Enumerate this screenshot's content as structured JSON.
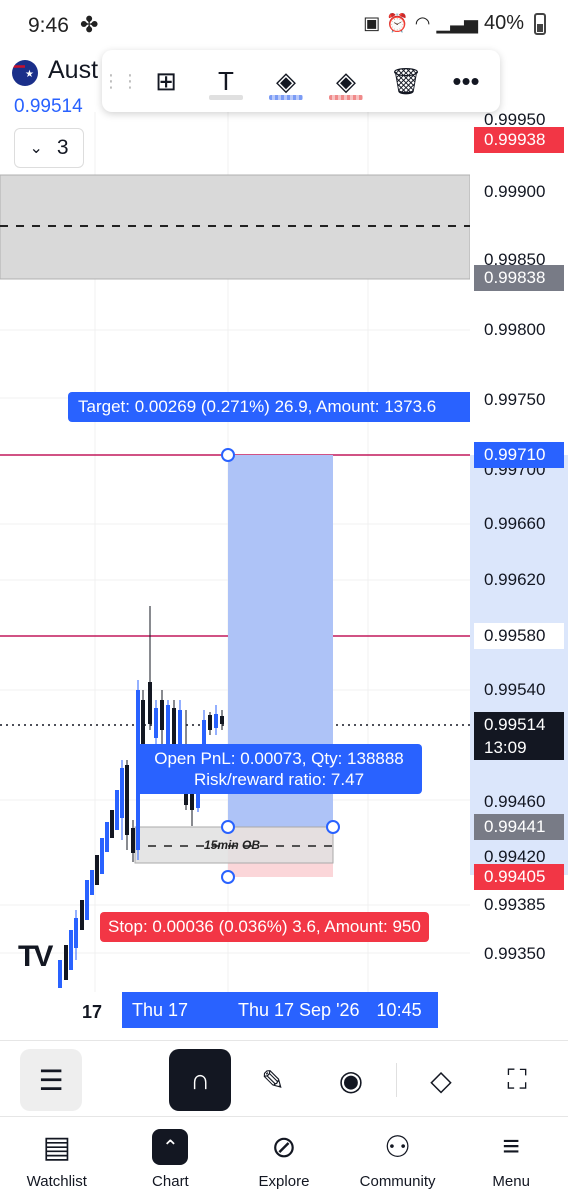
{
  "status_bar": {
    "time": "9:46",
    "battery": "40%"
  },
  "header": {
    "symbol": "Aust",
    "last_price": "0.99514",
    "interval": "3"
  },
  "drawing_toolbar": {
    "tools": [
      "drag-handle-icon",
      "add-object-icon",
      "text-icon",
      "fill-blue-icon",
      "fill-red-icon",
      "trash-icon",
      "more-icon"
    ]
  },
  "price_scale": {
    "ticks": [
      "0.99950",
      "0.99900",
      "0.99850",
      "0.99800",
      "0.99750",
      "0.99700",
      "0.99660",
      "0.99620",
      "0.99540",
      "0.99460",
      "0.99420",
      "0.99385",
      "0.99350"
    ],
    "labels": {
      "red_top": "0.99938",
      "grey_top": "0.99838",
      "blue_target": "0.99710",
      "red_mid": "0.99580",
      "current": "0.99514",
      "countdown": "13:09",
      "grey_entry": "0.99441",
      "red_stop": "0.99405"
    },
    "colors": {
      "red": "#f23645",
      "grey": "#787b86",
      "blue": "#2962ff",
      "black": "#131722"
    }
  },
  "position_tool": {
    "target_label": "Target: 0.00269 (0.271%) 26.9, Amount: 1373.6",
    "open_pnl": "Open PnL: 0.00073, Qty: 138888",
    "risk_reward": "Risk/reward ratio: 7.47",
    "stop_label": "Stop: 0.00036 (0.036%) 3.6, Amount: 950"
  },
  "annotations": {
    "order_block": "15min OB"
  },
  "time_axis": {
    "day_label": "17",
    "crosshair_left": "Thu 17 Sep",
    "crosshair_main": "Thu 17 Sep '26",
    "crosshair_time": "10:45"
  },
  "bottom_nav": {
    "items": [
      {
        "label": "Watchlist",
        "icon": "watchlist-icon"
      },
      {
        "label": "Chart",
        "icon": "chart-icon"
      },
      {
        "label": "Explore",
        "icon": "compass-icon"
      },
      {
        "label": "Community",
        "icon": "community-icon"
      },
      {
        "label": "Menu",
        "icon": "menu-icon"
      }
    ]
  }
}
